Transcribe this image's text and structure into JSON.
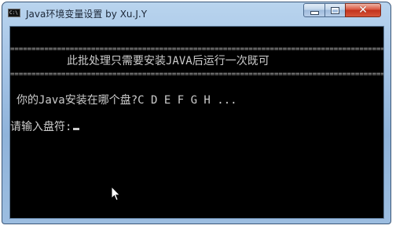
{
  "window": {
    "title": "Java环境变量设置 by Xu.J.Y",
    "icon": "console-icon",
    "controls": {
      "minimize_icon": "minimize-icon",
      "maximize_icon": "maximize-icon",
      "close_icon": "close-icon"
    }
  },
  "console": {
    "separator_top": "================================================================================================",
    "banner": "此批处理只需要安装JAVA后运行一次既可",
    "separator_bottom": "================================================================================================",
    "question": "你的Java安装在哪个盘?C D E F G H ...",
    "prompt": "请输入盘符:",
    "colors": {
      "background": "#000000",
      "text": "#cccccc"
    }
  },
  "pointer": "mouse-pointer-icon"
}
